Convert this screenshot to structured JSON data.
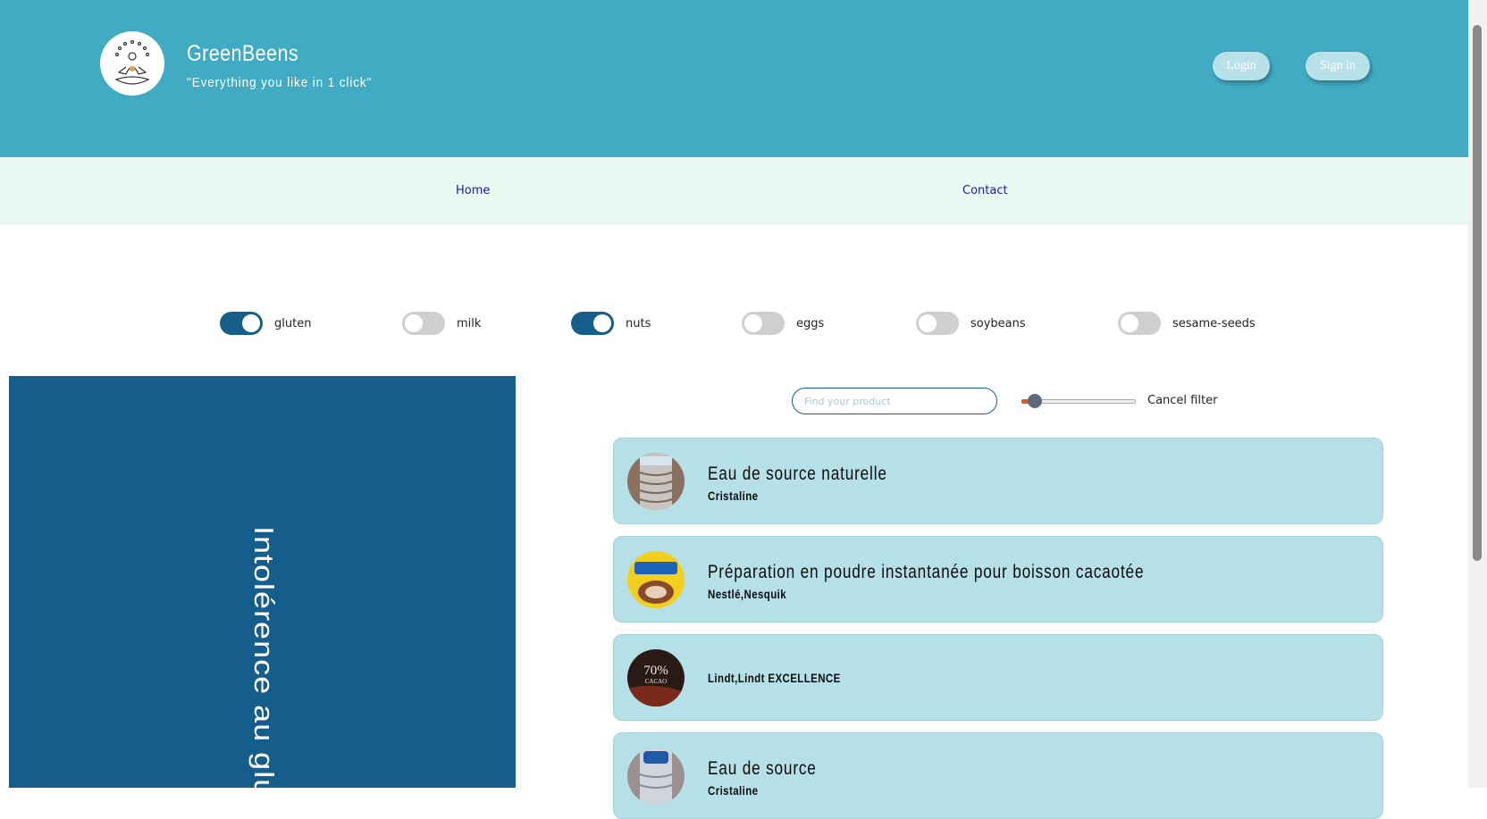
{
  "header": {
    "brand": "GreenBeens",
    "tagline": "\"Everything you like in 1 click\"",
    "login_label": "Login",
    "signin_label": "Sign in",
    "color": "#40abc3"
  },
  "nav": {
    "home": "Home",
    "contact": "Contact"
  },
  "allergens": [
    {
      "label": "gluten",
      "enabled": true
    },
    {
      "label": "milk",
      "enabled": false
    },
    {
      "label": "nuts",
      "enabled": true
    },
    {
      "label": "eggs",
      "enabled": false
    },
    {
      "label": "soybeans",
      "enabled": false
    },
    {
      "label": "sesame-seeds",
      "enabled": false
    }
  ],
  "side_panel": {
    "title": "Intolérence au gluten"
  },
  "filter": {
    "search_placeholder": "Find your product",
    "slider_value_fraction": 0.12,
    "cancel_label": "Cancel filter"
  },
  "products": [
    {
      "name": "Eau de source naturelle",
      "brand": "Cristaline",
      "image": "water-bottle"
    },
    {
      "name": "Préparation en poudre instantanée pour boisson cacaotée",
      "brand": "Nestlé,Nesquik",
      "image": "nesquik-box"
    },
    {
      "name": "",
      "brand": "Lindt,Lindt EXCELLENCE",
      "image": "chocolate-bar",
      "image_text": "70%",
      "image_subtext": "CACAO"
    },
    {
      "name": "Eau de source",
      "brand": "Cristaline",
      "image": "water-bottle"
    }
  ]
}
